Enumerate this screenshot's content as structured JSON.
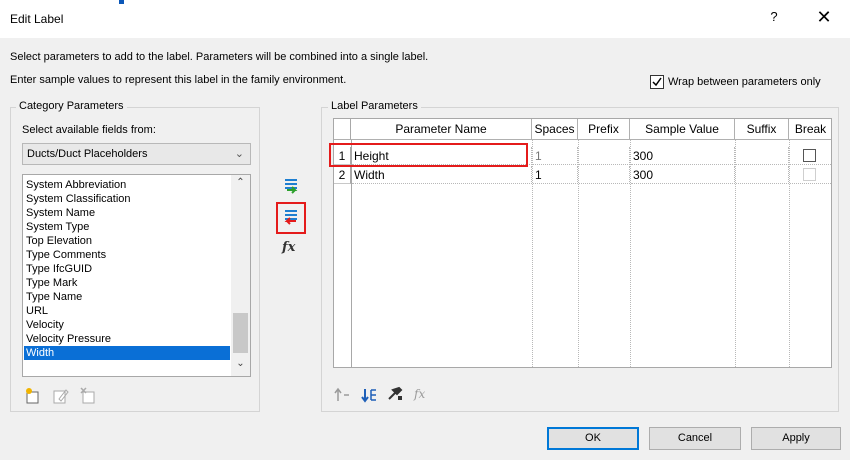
{
  "window": {
    "title": "Edit Label",
    "help": "?",
    "close": "✕"
  },
  "info": {
    "line1": "Select parameters to add to the label.  Parameters will be combined into a single label.",
    "line2": "Enter sample values to represent this label in the family environment."
  },
  "wrap": {
    "label": "Wrap between parameters only",
    "checked": true
  },
  "category": {
    "title": "Category Parameters",
    "select_label": "Select available fields from:",
    "combo_value": "Ducts/Duct Placeholders",
    "items": [
      "System Abbreviation",
      "System Classification",
      "System Name",
      "System Type",
      "Top Elevation",
      "Type Comments",
      "Type IfcGUID",
      "Type Mark",
      "Type Name",
      "URL",
      "Velocity",
      "Velocity Pressure",
      "Width"
    ],
    "selected": "Width"
  },
  "label_params": {
    "title": "Label Parameters",
    "columns": [
      "Parameter Name",
      "Spaces",
      "Prefix",
      "Sample Value",
      "Suffix",
      "Break"
    ],
    "rows": [
      {
        "num": "1",
        "name": "Height",
        "spaces": "1",
        "prefix": "",
        "sample": "300",
        "suffix": "",
        "break": false
      },
      {
        "num": "2",
        "name": "Width",
        "spaces": "1",
        "prefix": "",
        "sample": "300",
        "suffix": "",
        "break": false
      }
    ]
  },
  "buttons": {
    "ok": "OK",
    "cancel": "Cancel",
    "apply": "Apply"
  },
  "icons": {
    "add": "add-parameter-icon",
    "remove": "remove-parameter-icon",
    "formula": "fx",
    "new_param": "new-parameter-icon",
    "edit_param": "edit-parameter-icon",
    "delete_param": "delete-parameter-icon",
    "move_up": "move-up-icon",
    "move_down": "move-down-icon",
    "format": "format-icon",
    "formula_disabled": "fx"
  },
  "colors": {
    "selection": "#0a6fd6",
    "highlight": "#e41b1b",
    "ok_border": "#0078d7"
  }
}
